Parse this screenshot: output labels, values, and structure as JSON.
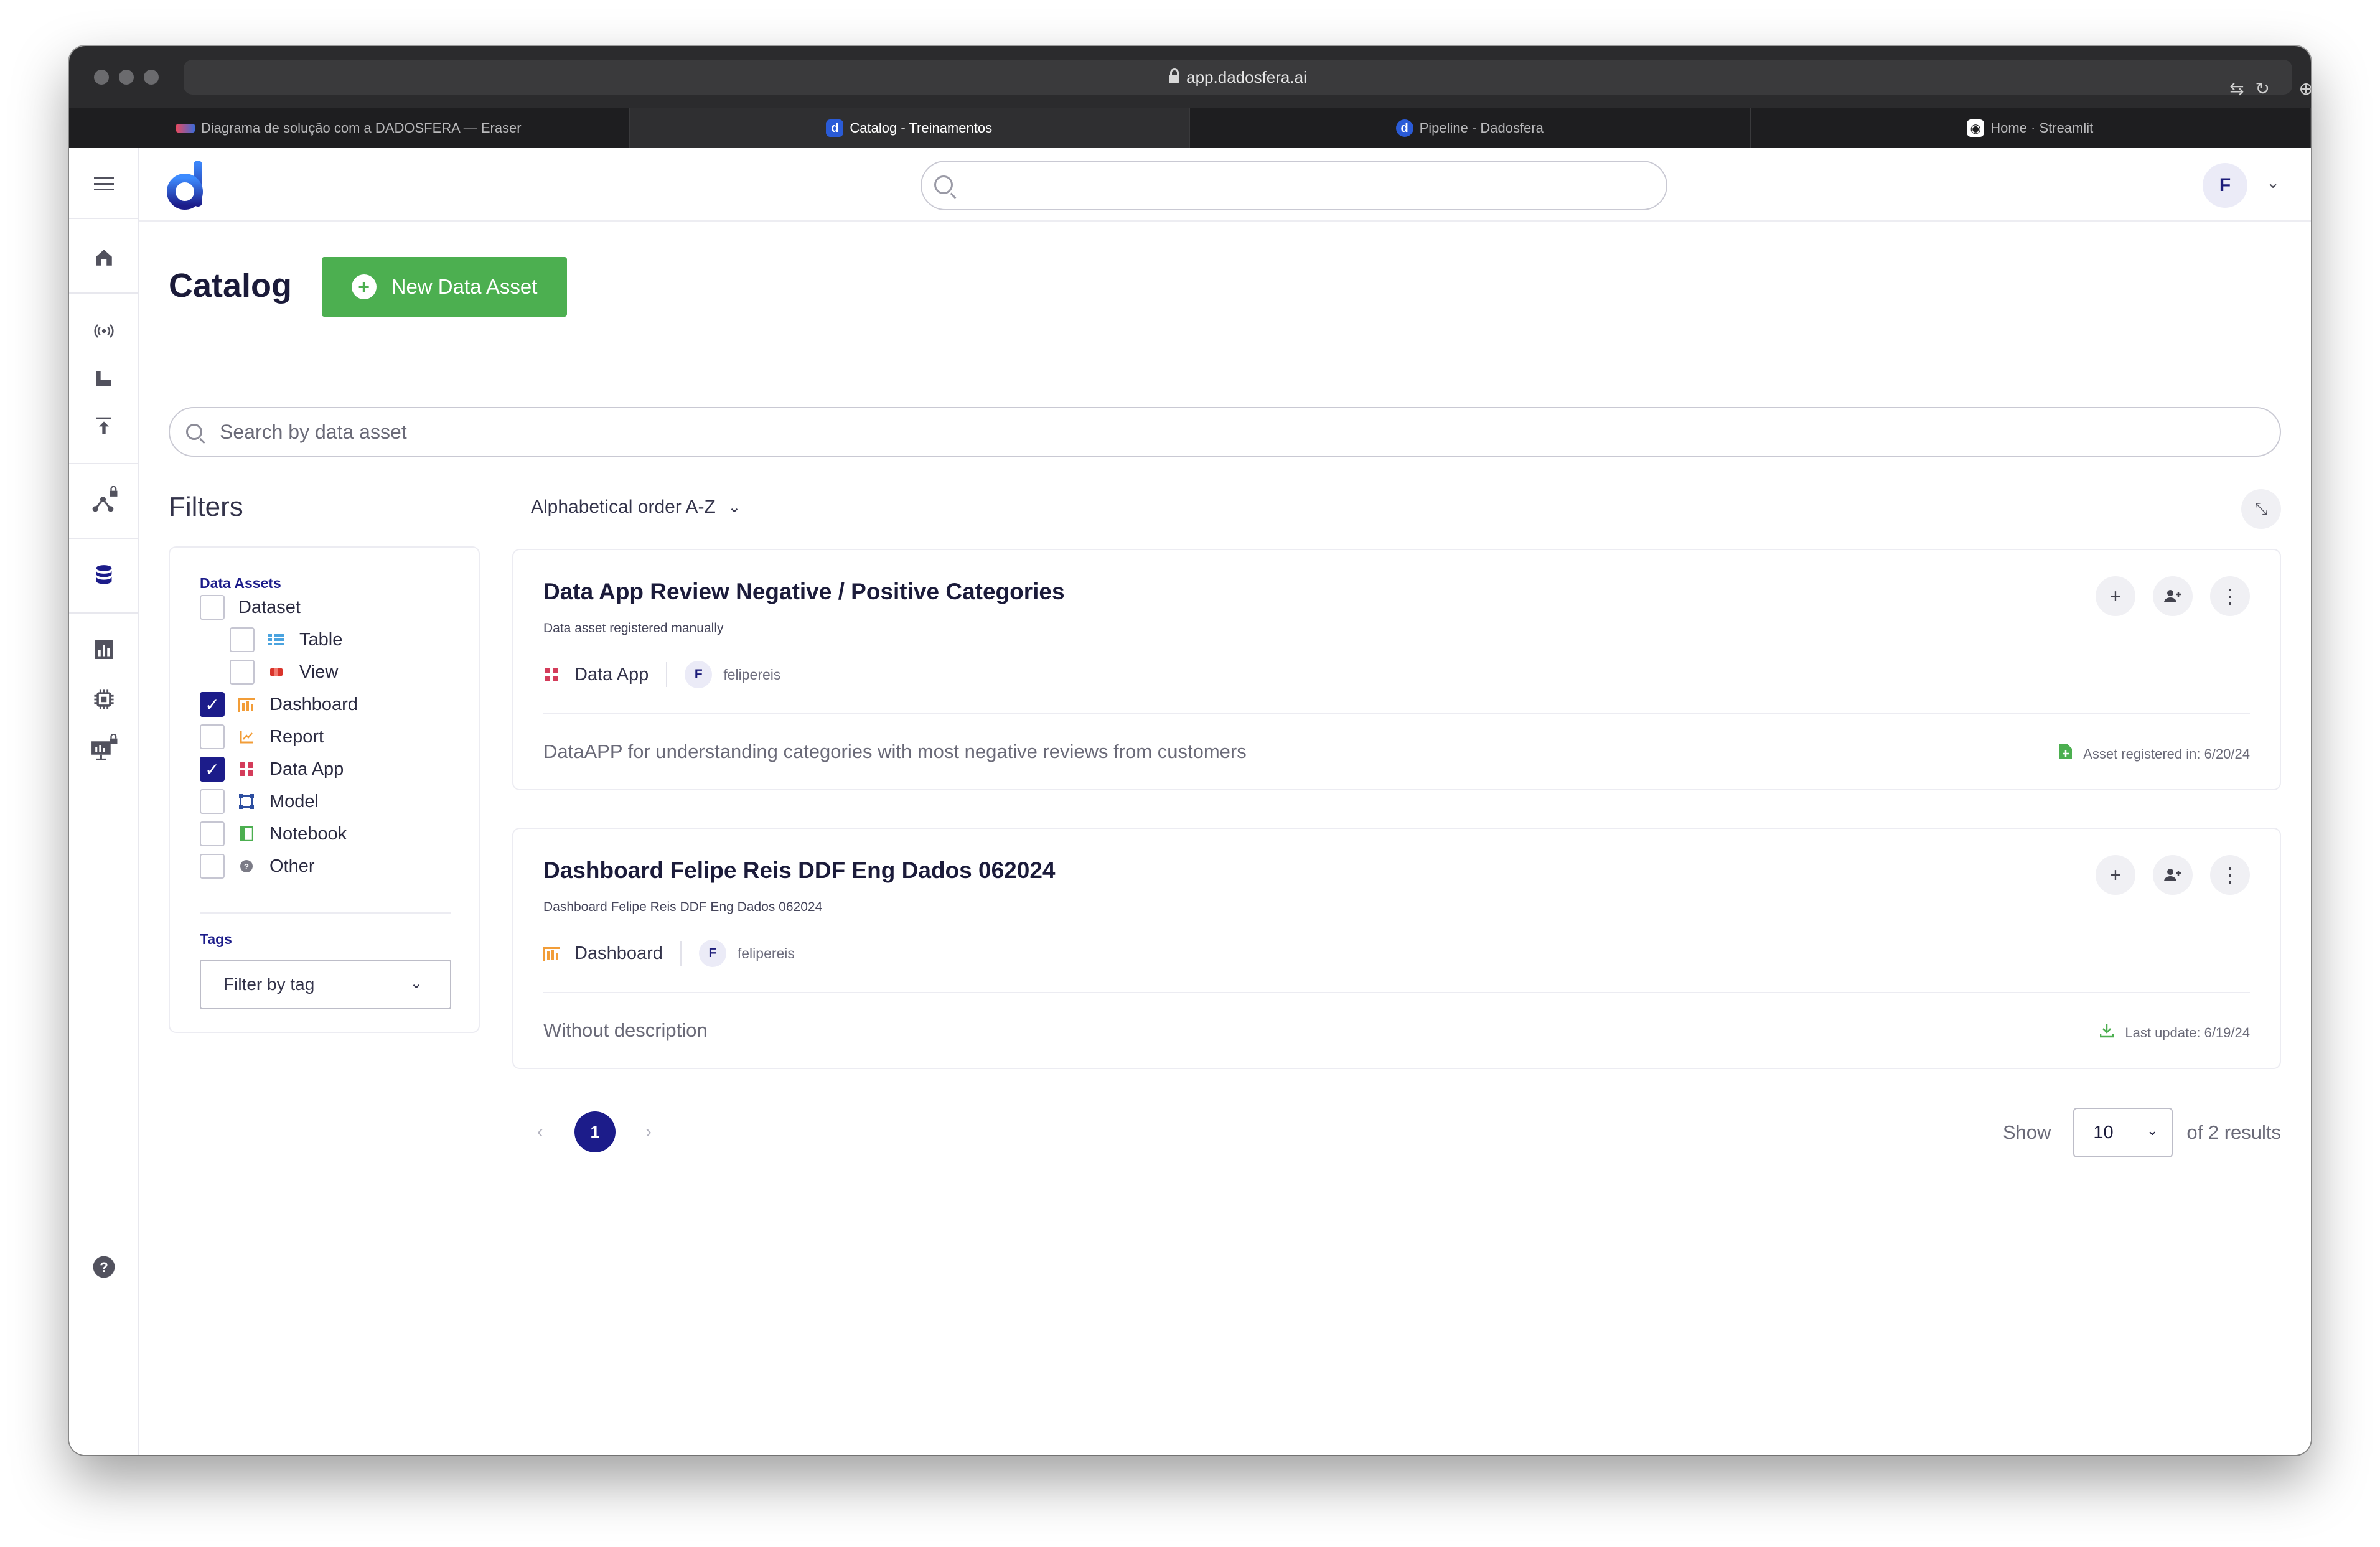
{
  "browser": {
    "url": "app.dadosfera.ai",
    "tabs": [
      {
        "title": "Diagrama de solução com a DADOSFERA — Eraser",
        "active": false
      },
      {
        "title": "Catalog - Treinamentos",
        "active": true
      },
      {
        "title": "Pipeline - Dadosfera",
        "active": false
      },
      {
        "title": "Home · Streamlit",
        "active": false
      }
    ]
  },
  "header": {
    "avatar_initial": "F",
    "search_placeholder": ""
  },
  "page": {
    "title": "Catalog",
    "new_button_label": "New Data Asset",
    "search_placeholder": "Search by data asset"
  },
  "filters": {
    "title": "Filters",
    "data_assets_label": "Data Assets",
    "items": [
      {
        "label": "Dataset",
        "checked": false,
        "icon": "dataset"
      },
      {
        "label": "Table",
        "checked": false,
        "icon": "table-icon"
      },
      {
        "label": "View",
        "checked": false,
        "icon": "view-icon"
      },
      {
        "label": "Dashboard",
        "checked": true,
        "icon": "dashboard-icon"
      },
      {
        "label": "Report",
        "checked": false,
        "icon": "report-icon"
      },
      {
        "label": "Data App",
        "checked": true,
        "icon": "data-app-icon"
      },
      {
        "label": "Model",
        "checked": false,
        "icon": "model-icon"
      },
      {
        "label": "Notebook",
        "checked": false,
        "icon": "notebook-icon"
      },
      {
        "label": "Other",
        "checked": false,
        "icon": "other-icon"
      }
    ],
    "tags_label": "Tags",
    "tag_select": "Filter by tag"
  },
  "sort": {
    "label": "Alphabetical order A-Z"
  },
  "results": [
    {
      "title": "Data App Review Negative / Positive Categories",
      "subtitle": "Data asset registered manually",
      "type": "Data App",
      "owner_initial": "F",
      "owner": "felipereis",
      "description": "DataAPP for understanding categories with most negative reviews from customers",
      "date": "Asset registered in: 6/20/24"
    },
    {
      "title": "Dashboard Felipe Reis DDF Eng Dados 062024",
      "subtitle": "Dashboard Felipe Reis DDF Eng Dados 062024",
      "type": "Dashboard",
      "owner_initial": "F",
      "owner": "felipereis",
      "description": "Without description",
      "date": "Last update: 6/19/24"
    }
  ],
  "pagination": {
    "current_page": "1",
    "show_label": "Show",
    "page_size": "10",
    "total_label": "of 2 results"
  },
  "colors": {
    "primary": "#1c1c8a",
    "accent_green": "#4caf50",
    "dashboard_orange": "#f29d38",
    "data_app_red": "#d43c5a"
  }
}
